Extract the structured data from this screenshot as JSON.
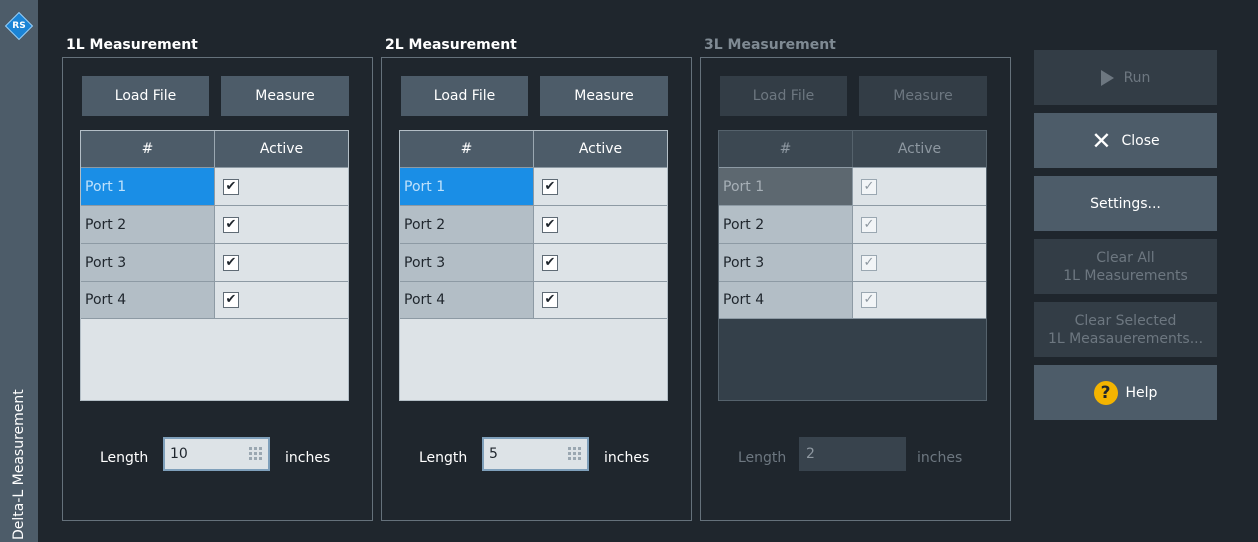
{
  "sidebar": {
    "title": "Delta-L Measurement",
    "logo_text": "RS"
  },
  "groups": [
    {
      "title": "1L Measurement",
      "load_label": "Load File",
      "measure_label": "Measure",
      "col_port": "#",
      "col_active": "Active",
      "rows": [
        "Port 1",
        "Port 2",
        "Port 3",
        "Port 4"
      ],
      "check": "✔",
      "length_label": "Length",
      "length_value": "10",
      "unit": "inches"
    },
    {
      "title": "2L Measurement",
      "load_label": "Load File",
      "measure_label": "Measure",
      "col_port": "#",
      "col_active": "Active",
      "rows": [
        "Port 1",
        "Port 2",
        "Port 3",
        "Port 4"
      ],
      "check": "✔",
      "length_label": "Length",
      "length_value": "5",
      "unit": "inches"
    },
    {
      "title": "3L Measurement",
      "load_label": "Load File",
      "measure_label": "Measure",
      "col_port": "#",
      "col_active": "Active",
      "rows": [
        "Port 1",
        "Port 2",
        "Port 3",
        "Port 4"
      ],
      "check": "✓",
      "length_label": "Length",
      "length_value": "2",
      "unit": "inches"
    }
  ],
  "actions": {
    "run": "Run",
    "close": "Close",
    "settings": "Settings...",
    "clear_all_1": "Clear All",
    "clear_all_2": "1L Measurements",
    "clear_selected_1": "Clear Selected",
    "clear_selected_2": "1L Measauerements...",
    "help": "Help",
    "help_glyph": "?"
  },
  "colors": {
    "background": "#1f262d",
    "button": "#4d5c69",
    "selection": "#1a8ee6",
    "help_icon": "#f4b400"
  }
}
